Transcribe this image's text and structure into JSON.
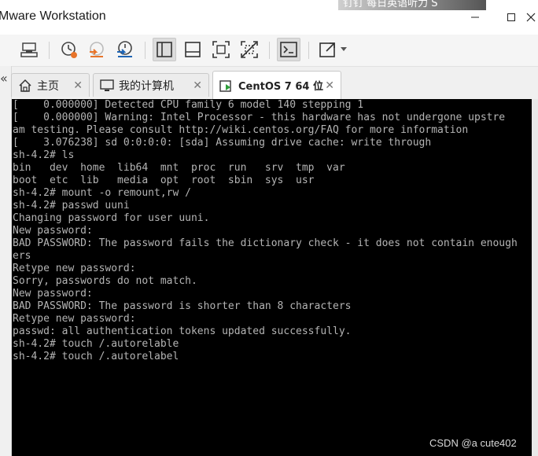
{
  "window": {
    "title": "Mware Workstation",
    "overlay_text": "钉钉  每日英语听力 S",
    "minimize_label": "—",
    "maximize_label": "☐",
    "close_label": "✕"
  },
  "toolbar": {
    "items": [
      {
        "name": "vm-settings-icon"
      },
      {
        "name": "snapshot-icon"
      },
      {
        "name": "revert-snapshot-icon"
      },
      {
        "name": "snapshot-manager-icon"
      },
      {
        "name": "show-library-icon"
      },
      {
        "name": "thumbnail-bar-icon"
      },
      {
        "name": "full-screen-icon"
      },
      {
        "name": "unity-icon"
      },
      {
        "name": "console-view-icon"
      },
      {
        "name": "stretch-guest-icon"
      },
      {
        "name": "stretch-dropdown-icon"
      }
    ]
  },
  "left_edge": {
    "arrow": "«"
  },
  "tabs": [
    {
      "label": "主页",
      "close": "✕",
      "icon": "home-icon"
    },
    {
      "label": "我的计算机",
      "close": "✕",
      "icon": "computer-icon"
    },
    {
      "label": "CentOS 7 64 位",
      "close": "✕",
      "icon": "vm-running-icon",
      "active": true
    }
  ],
  "console": {
    "lines": [
      "[    0.000000] Detected CPU family 6 model 140 stepping 1",
      "[    0.000000] Warning: Intel Processor - this hardware has not undergone upstre",
      "am testing. Please consult http://wiki.centos.org/FAQ for more information",
      "[    3.076238] sd 0:0:0:0: [sda] Assuming drive cache: write through",
      "sh-4.2# ls",
      "bin   dev  home  lib64  mnt  proc  run   srv  tmp  var",
      "boot  etc  lib   media  opt  root  sbin  sys  usr",
      "sh-4.2# mount -o remount,rw /",
      "sh-4.2# passwd uuni",
      "Changing password for user uuni.",
      "New password:",
      "BAD PASSWORD: The password fails the dictionary check - it does not contain enough",
      "ers",
      "Retype new password:",
      "Sorry, passwords do not match.",
      "New password:",
      "BAD PASSWORD: The password is shorter than 8 characters",
      "Retype new password:",
      "passwd: all authentication tokens updated successfully.",
      "sh-4.2# touch /.autorelable",
      "sh-4.2# touch /.autorelabel"
    ]
  },
  "watermark": "CSDN @a cute402",
  "colors": {
    "console_bg": "#000000",
    "console_text": "#b4b4b4",
    "icon_blue": "#1e64b4",
    "icon_orange": "#e8742a"
  }
}
